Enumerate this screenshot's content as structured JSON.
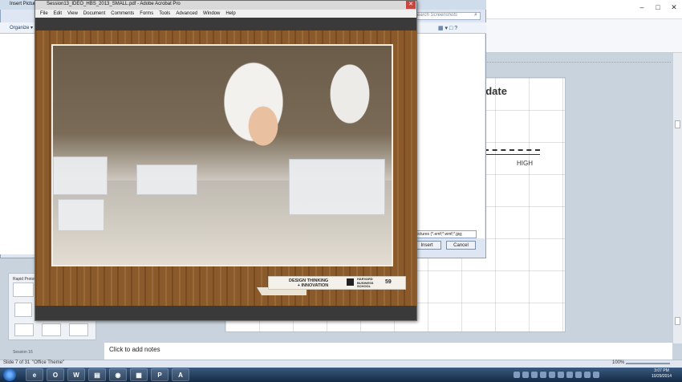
{
  "dialog": {
    "title": "Insert Picture",
    "organize_label": "Organize ▾",
    "search_placeholder": "Search Screenshots",
    "filetype_value": "Pictures (*.emf;*.wmf;*.jpg;",
    "insert_label": "Insert",
    "cancel_label": "Cancel"
  },
  "acrobat": {
    "title": "Session13_IDEO_HBS_2013_SMALL.pdf - Adobe Acrobat Pro",
    "close_label": "✕",
    "menu": [
      "File",
      "Edit",
      "View",
      "Document",
      "Comments",
      "Forms",
      "Tools",
      "Advanced",
      "Window",
      "Help"
    ],
    "footer_line1": "DESIGN THINKING",
    "footer_line2": "+ INNOVATION",
    "school_line1": "HARVARD",
    "school_line2": "BUSINESS",
    "school_line3": "SCHOOL",
    "page_number": "59"
  },
  "powerpoint": {
    "slide_title_fragment": "lidate",
    "slide_label_high": "HIGH",
    "notes_placeholder": "Click to add notes",
    "status_slide": "Slide 7 of 31",
    "status_theme": "\"Office Theme\"",
    "zoom": "100%",
    "thumb_panel_label": "Rapid Prototyping",
    "session_label": "Session 16"
  },
  "taskbar": {
    "time": "3:07 PM",
    "date": "10/29/2014",
    "apps": [
      {
        "name": "ie",
        "glyph": "e"
      },
      {
        "name": "outlook",
        "glyph": "O"
      },
      {
        "name": "word",
        "glyph": "W"
      },
      {
        "name": "explorer",
        "glyph": "▤"
      },
      {
        "name": "chrome",
        "glyph": "◉"
      },
      {
        "name": "photos",
        "glyph": "▦"
      },
      {
        "name": "powerpoint",
        "glyph": "P"
      },
      {
        "name": "acrobat",
        "glyph": "A"
      }
    ]
  }
}
